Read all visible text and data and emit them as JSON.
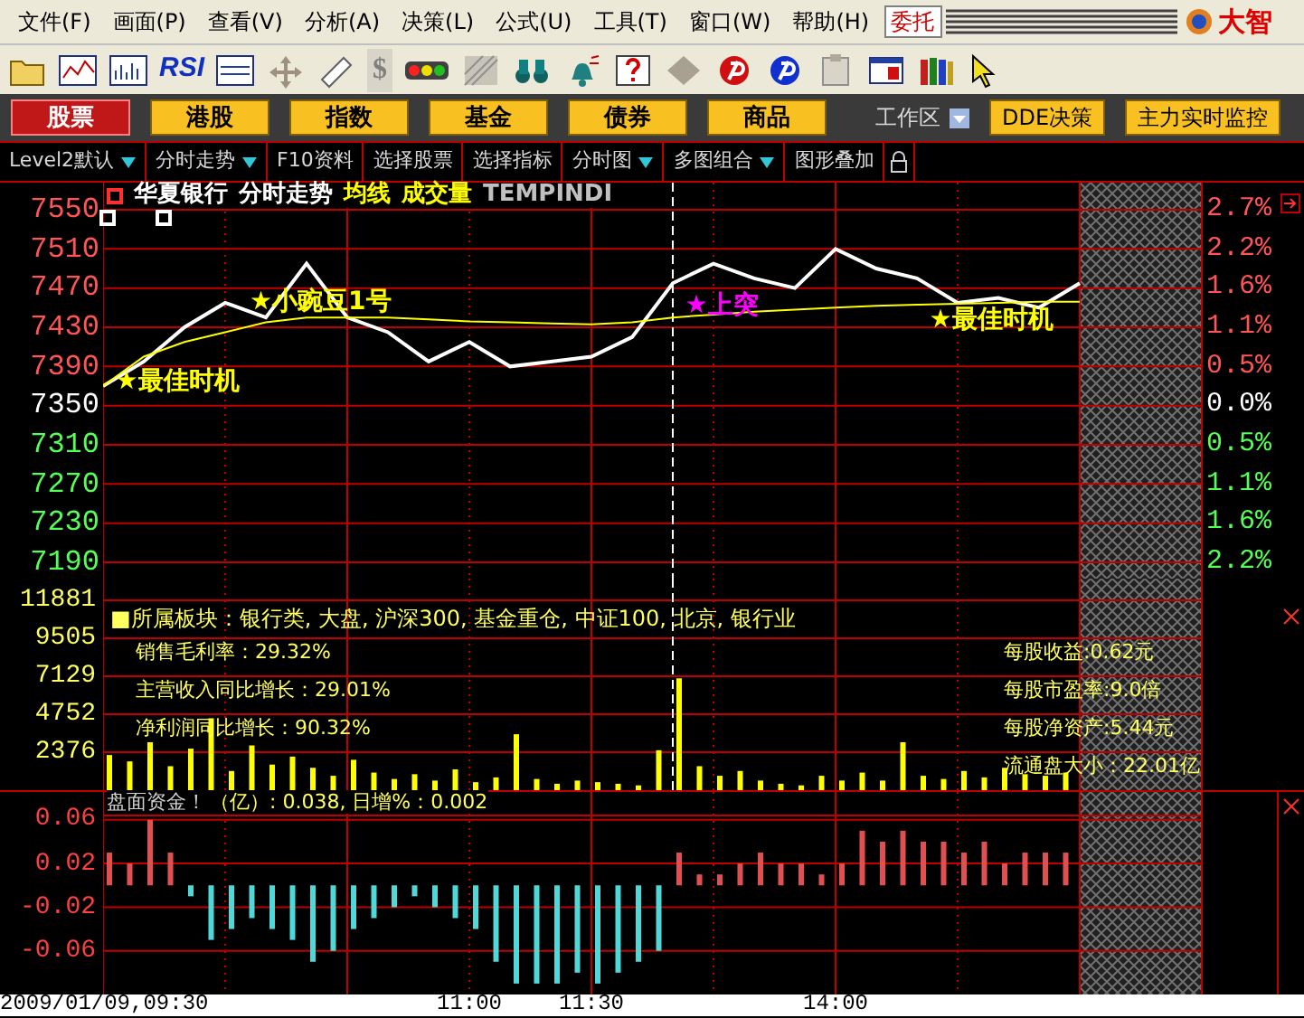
{
  "menu": {
    "items": [
      "文件(F)",
      "画面(P)",
      "查看(V)",
      "分析(A)",
      "决策(L)",
      "公式(U)",
      "工具(T)",
      "窗口(W)",
      "帮助(H)"
    ],
    "trade_button": "委托",
    "logo_text": "大智"
  },
  "toolbar": {
    "rsi_label": "RSI",
    "dollar_label": "$"
  },
  "market_tabs": [
    {
      "label": "股票",
      "selected": true
    },
    {
      "label": "港股",
      "selected": false
    },
    {
      "label": "指数",
      "selected": false
    },
    {
      "label": "基金",
      "selected": false
    },
    {
      "label": "债券",
      "selected": false
    },
    {
      "label": "商品",
      "selected": false
    }
  ],
  "workspace": {
    "label": "工作区",
    "buttons": [
      "DDE决策",
      "主力实时监控"
    ]
  },
  "subbar": [
    {
      "label": "Level2默认",
      "dropdown": true
    },
    {
      "label": "分时走势",
      "dropdown": true
    },
    {
      "label": "F10资料",
      "dropdown": false
    },
    {
      "label": "选择股票",
      "dropdown": false
    },
    {
      "label": "选择指标",
      "dropdown": false
    },
    {
      "label": "分时图",
      "dropdown": true
    },
    {
      "label": "多图组合",
      "dropdown": true
    },
    {
      "label": "图形叠加",
      "dropdown": false
    }
  ],
  "price_chart": {
    "legend": [
      {
        "label": "华夏银行",
        "color": "#ffffff"
      },
      {
        "label": "分时走势",
        "color": "#ffffff"
      },
      {
        "label": "均线",
        "color": "#ffff00"
      },
      {
        "label": "成交量",
        "color": "#ffff00"
      },
      {
        "label": "TEMPINDI"
      }
    ],
    "signals": [
      {
        "text": "★最佳时机",
        "color": "#ffff00"
      },
      {
        "text": "★小豌豆1号",
        "color": "#ffff00"
      },
      {
        "text": "★上突",
        "color": "#ff00ff"
      },
      {
        "text": "★最佳时机",
        "color": "#ffff00"
      }
    ],
    "right_ticks": [
      {
        "label": "2.7%",
        "kind": "up"
      },
      {
        "label": "2.2%",
        "kind": "up"
      },
      {
        "label": "1.6%",
        "kind": "up"
      },
      {
        "label": "1.1%",
        "kind": "up"
      },
      {
        "label": "0.5%",
        "kind": "up"
      },
      {
        "label": "0.0%",
        "kind": "flat"
      },
      {
        "label": "0.5%",
        "kind": "down"
      },
      {
        "label": "1.1%",
        "kind": "down"
      },
      {
        "label": "1.6%",
        "kind": "down"
      },
      {
        "label": "2.2%",
        "kind": "down"
      }
    ],
    "chart_data": {
      "type": "line",
      "grid": true,
      "series": [
        {
          "color": "#ffffff",
          "values": [
            7370,
            7395,
            7430,
            7455,
            7440,
            7495,
            7440,
            7425,
            7395,
            7415,
            7390,
            7395,
            7400,
            7420,
            7475,
            7495,
            7480,
            7470,
            7510,
            7490,
            7480,
            7455,
            7460,
            7450,
            7475
          ]
        },
        {
          "color": "#ffff00",
          "values": [
            7370,
            7400,
            7415,
            7425,
            7435,
            7440,
            7440,
            7440,
            7438,
            7436,
            7435,
            7434,
            7433,
            7435,
            7440,
            7443,
            7446,
            7448,
            7450,
            7452,
            7453,
            7454,
            7455,
            7456,
            7456
          ]
        }
      ],
      "ylim": [
        7190,
        7550
      ],
      "yticks": [
        {
          "value": 7550,
          "label": "7550"
        },
        {
          "value": 7510,
          "label": "7510"
        },
        {
          "value": 7470,
          "label": "7470"
        },
        {
          "value": 7430,
          "label": "7430"
        },
        {
          "value": 7390,
          "label": "7390"
        },
        {
          "value": 7350,
          "label": "7350"
        },
        {
          "value": 7310,
          "label": "7310"
        },
        {
          "value": 7270,
          "label": "7270"
        },
        {
          "value": 7230,
          "label": "7230"
        },
        {
          "value": 7190,
          "label": "7190"
        }
      ]
    }
  },
  "volume_chart": {
    "sector": "■所属板块：银行类, 大盘, 沪深300, 基金重仓, 中证100, 北京, 银行业",
    "left_info": [
      "销售毛利率：29.32%",
      "主营收入同比增长：29.01%",
      "净利润同比增长：90.32%"
    ],
    "right_info": [
      "每股收益:0.62元",
      "每股市盈率:9.0倍",
      "每股净资产:5.44元",
      "流通盘大小：22.01亿"
    ],
    "chart_data": {
      "type": "bar",
      "grid": true,
      "series": [
        {
          "color": "#ffff00",
          "values": [
            2200,
            1800,
            3000,
            1500,
            2600,
            4500,
            1200,
            2800,
            1600,
            2100,
            1400,
            900,
            1900,
            1100,
            700,
            1000,
            600,
            1300,
            500,
            800,
            3500,
            700,
            400,
            600,
            500,
            400,
            300,
            2500,
            7000,
            1500,
            900,
            1200,
            600,
            400,
            300,
            900,
            600,
            1100,
            600,
            3000,
            900,
            700,
            1200,
            800,
            1400,
            1000,
            900,
            1100
          ]
        }
      ],
      "ylim": [
        0,
        11881
      ],
      "yticks": [
        {
          "value": 11881,
          "label": "11881"
        },
        {
          "value": 9505,
          "label": "9505"
        },
        {
          "value": 7129,
          "label": "7129"
        },
        {
          "value": 4752,
          "label": "4752"
        },
        {
          "value": 2376,
          "label": "2376"
        }
      ]
    }
  },
  "capital_chart": {
    "title": "盘面资金！",
    "reading": "（亿）: 0.038, 日增%：0.002",
    "chart_data": {
      "type": "bar",
      "grid": true,
      "series": [
        {
          "color": "#e05050",
          "values": [
            0.03,
            0.02,
            0.06,
            0.03,
            null,
            null,
            null,
            null,
            null,
            null,
            null,
            null,
            null,
            null,
            null,
            null,
            null,
            null,
            null,
            null,
            null,
            null,
            null,
            null,
            null,
            null,
            null,
            null,
            0.03,
            0.01,
            0.01,
            0.02,
            0.03,
            0.02,
            0.02,
            0.01,
            0.02,
            0.05,
            0.04,
            0.05,
            0.04,
            0.04,
            0.03,
            0.04,
            0.02,
            0.03,
            0.03,
            0.03
          ]
        },
        {
          "color": "#50d8d8",
          "values": [
            null,
            null,
            null,
            null,
            -0.01,
            -0.05,
            -0.04,
            -0.03,
            -0.04,
            -0.05,
            -0.07,
            -0.06,
            -0.04,
            -0.03,
            -0.02,
            -0.01,
            -0.02,
            -0.03,
            -0.04,
            -0.07,
            -0.09,
            -0.09,
            -0.09,
            -0.08,
            -0.09,
            -0.08,
            -0.07,
            -0.06,
            null,
            null,
            null,
            null,
            null,
            null,
            null,
            null,
            null,
            null,
            null,
            null,
            null,
            null,
            null,
            null,
            null,
            null,
            null,
            null
          ]
        }
      ],
      "ylim": [
        -0.1,
        0.064
      ],
      "yticks": [
        {
          "value": 0.06,
          "label": "0.06"
        },
        {
          "value": 0.02,
          "label": "0.02"
        },
        {
          "value": -0.02,
          "label": "-0.02"
        },
        {
          "value": -0.06,
          "label": "-0.06"
        }
      ]
    }
  },
  "time_axis": [
    {
      "label": "2009/01/09,09:30"
    },
    {
      "label": "11:00"
    },
    {
      "label": "11:30"
    },
    {
      "label": "14:00"
    }
  ]
}
